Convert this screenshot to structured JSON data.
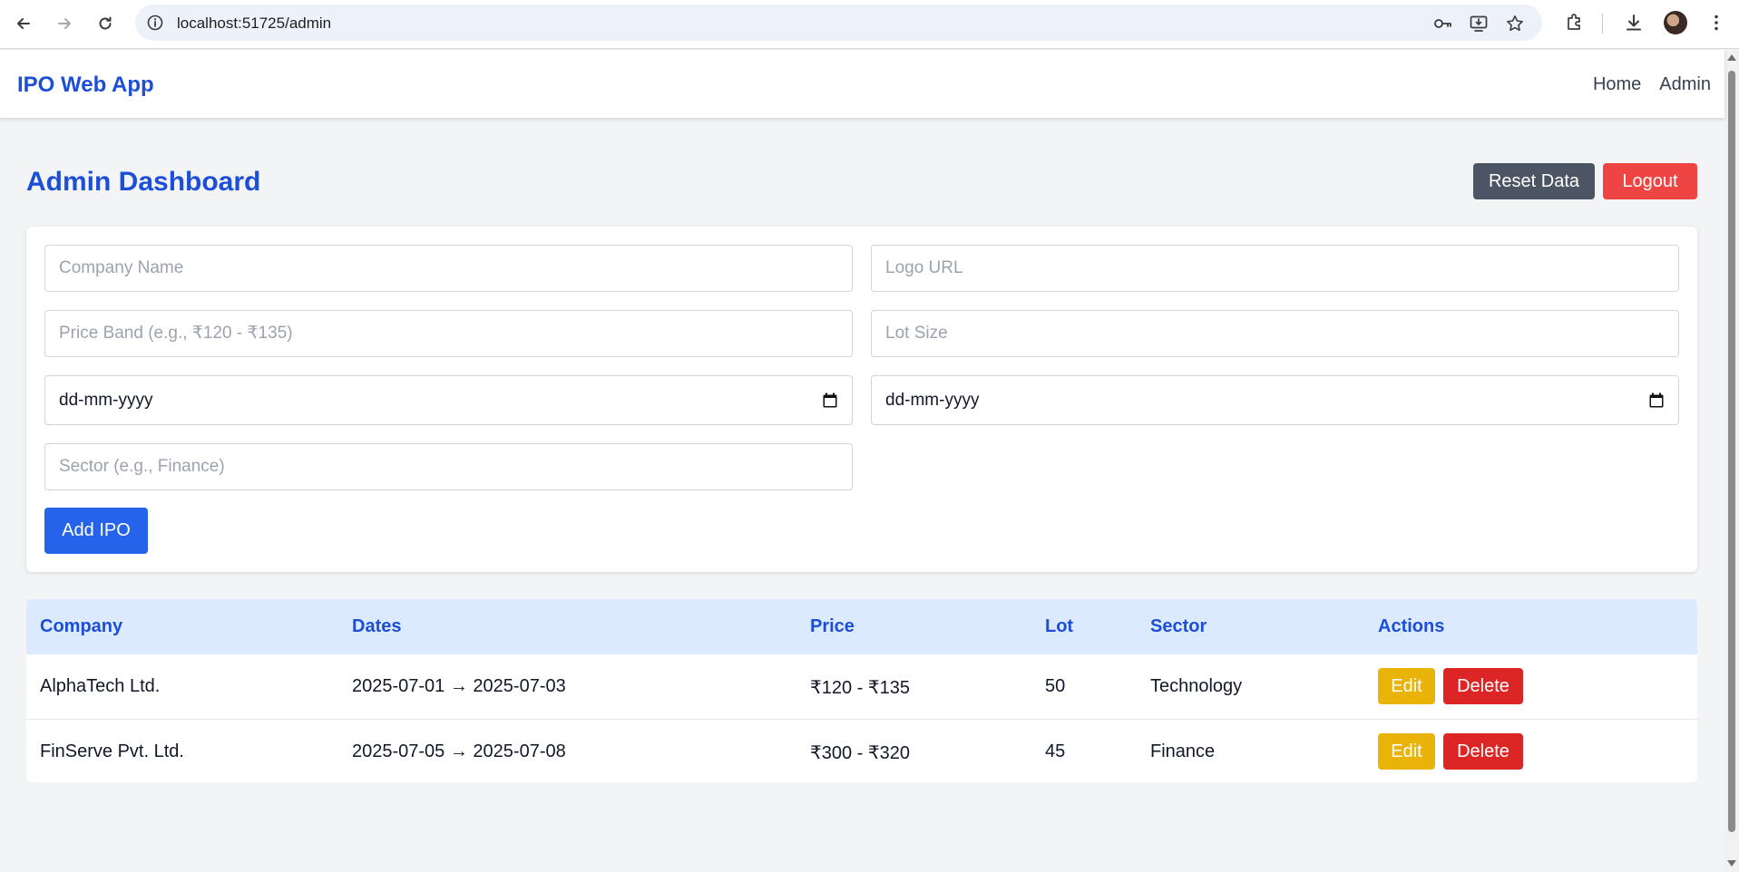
{
  "browser": {
    "url": "localhost:51725/admin"
  },
  "app": {
    "brand": "IPO Web App",
    "nav": [
      {
        "label": "Home"
      },
      {
        "label": "Admin"
      }
    ]
  },
  "dashboard": {
    "title": "Admin Dashboard",
    "reset_label": "Reset Data",
    "logout_label": "Logout"
  },
  "form": {
    "company_name_placeholder": "Company Name",
    "logo_url_placeholder": "Logo URL",
    "price_band_placeholder": "Price Band (e.g., ₹120 - ₹135)",
    "lot_size_placeholder": "Lot Size",
    "open_date_value": "dd-mm-yyyy",
    "close_date_value": "dd-mm-yyyy",
    "sector_placeholder": "Sector (e.g., Finance)",
    "add_label": "Add IPO"
  },
  "table": {
    "headers": [
      "Company",
      "Dates",
      "Price",
      "Lot",
      "Sector",
      "Actions"
    ],
    "rows": [
      {
        "company": "AlphaTech Ltd.",
        "dates": "2025-07-01 → 2025-07-03",
        "price": "₹120 - ₹135",
        "lot": "50",
        "sector": "Technology",
        "edit": "Edit",
        "delete": "Delete"
      },
      {
        "company": "FinServe Pvt. Ltd.",
        "dates": "2025-07-05 → 2025-07-08",
        "price": "₹300 - ₹320",
        "lot": "45",
        "sector": "Finance",
        "edit": "Edit",
        "delete": "Delete"
      }
    ]
  },
  "colors": {
    "brand": "#1d4ed8",
    "primary_button": "#2563eb",
    "reset_button": "#4b5563",
    "logout_button": "#ef4444",
    "edit_button": "#eab308",
    "delete_button": "#dc2626",
    "table_header_bg": "#dbeafe"
  },
  "icons": {
    "back": "arrow-left-icon",
    "forward": "arrow-right-icon",
    "reload": "reload-icon",
    "site_info": "info-icon",
    "password": "key-icon",
    "install": "install-app-icon",
    "bookmark": "star-icon",
    "extensions": "puzzle-icon",
    "downloads": "download-icon",
    "menu": "kebab-menu-icon",
    "calendar": "calendar-icon"
  }
}
